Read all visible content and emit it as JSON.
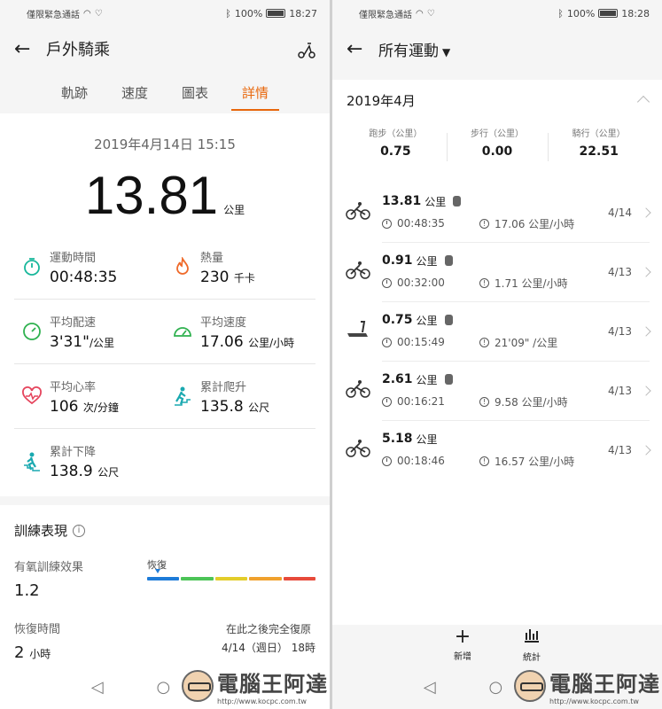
{
  "status_left": {
    "carrier": "僅限緊急通話"
  },
  "status_right_left_panel": {
    "battery": "100%",
    "time": "18:27"
  },
  "status_right_right_panel": {
    "battery": "100%",
    "time": "18:28"
  },
  "left": {
    "title": "戶外騎乘",
    "tabs": [
      "軌跡",
      "速度",
      "圖表",
      "詳情"
    ],
    "active_tab": "詳情",
    "datetime": "2019年4月14日 15:15",
    "distance": "13.81",
    "distance_unit": "公里",
    "metrics": {
      "time": {
        "label": "運動時間",
        "value": "00:48:35"
      },
      "calories": {
        "label": "熱量",
        "value": "230",
        "unit": "千卡"
      },
      "pace": {
        "label": "平均配速",
        "value": "3'31\"",
        "unit": "/公里"
      },
      "speed": {
        "label": "平均速度",
        "value": "17.06",
        "unit": "公里/小時"
      },
      "heart": {
        "label": "平均心率",
        "value": "106",
        "unit": "次/分鐘"
      },
      "ascent": {
        "label": "累計爬升",
        "value": "135.8",
        "unit": "公尺"
      },
      "descent": {
        "label": "累計下降",
        "value": "138.9",
        "unit": "公尺"
      }
    },
    "training": {
      "title": "訓練表現",
      "aerobic_label": "有氧訓練效果",
      "aerobic_value": "1.2",
      "scale_label": "恢復",
      "scale_colors": [
        "#1d7bd8",
        "#4cc457",
        "#e3cd2a",
        "#f0a12d",
        "#e74a3a"
      ],
      "recovery_label": "恢復時間",
      "recovery_value": "2",
      "recovery_unit": "小時",
      "full_recovery_title": "在此之後完全復原",
      "full_recovery_date": "4/14（週日） 18時"
    }
  },
  "right": {
    "title": "所有運動",
    "month": "2019年4月",
    "totals": [
      {
        "label": "跑步（公里）",
        "value": "0.75"
      },
      {
        "label": "步行（公里）",
        "value": "0.00"
      },
      {
        "label": "騎行（公里）",
        "value": "22.51"
      }
    ],
    "items": [
      {
        "icon": "bike-icon",
        "distance": "13.81",
        "unit": "公里",
        "duration": "00:48:35",
        "speed": "17.06 公里/小時",
        "date": "4/14",
        "watch": true
      },
      {
        "icon": "bike-icon",
        "distance": "0.91",
        "unit": "公里",
        "duration": "00:32:00",
        "speed": "1.71 公里/小時",
        "date": "4/13",
        "watch": true
      },
      {
        "icon": "treadmill-icon",
        "distance": "0.75",
        "unit": "公里",
        "duration": "00:15:49",
        "speed": "21'09\" /公里",
        "date": "4/13",
        "watch": true
      },
      {
        "icon": "bike-icon",
        "distance": "2.61",
        "unit": "公里",
        "duration": "00:16:21",
        "speed": "9.58 公里/小時",
        "date": "4/13",
        "watch": true
      },
      {
        "icon": "bike-icon",
        "distance": "5.18",
        "unit": "公里",
        "duration": "00:18:46",
        "speed": "16.57 公里/小時",
        "date": "4/13",
        "watch": false
      }
    ],
    "add_label": "新增",
    "stats_label": "統計"
  },
  "watermark": {
    "name": "電腦王阿達",
    "url": "http://www.kocpc.com.tw"
  }
}
